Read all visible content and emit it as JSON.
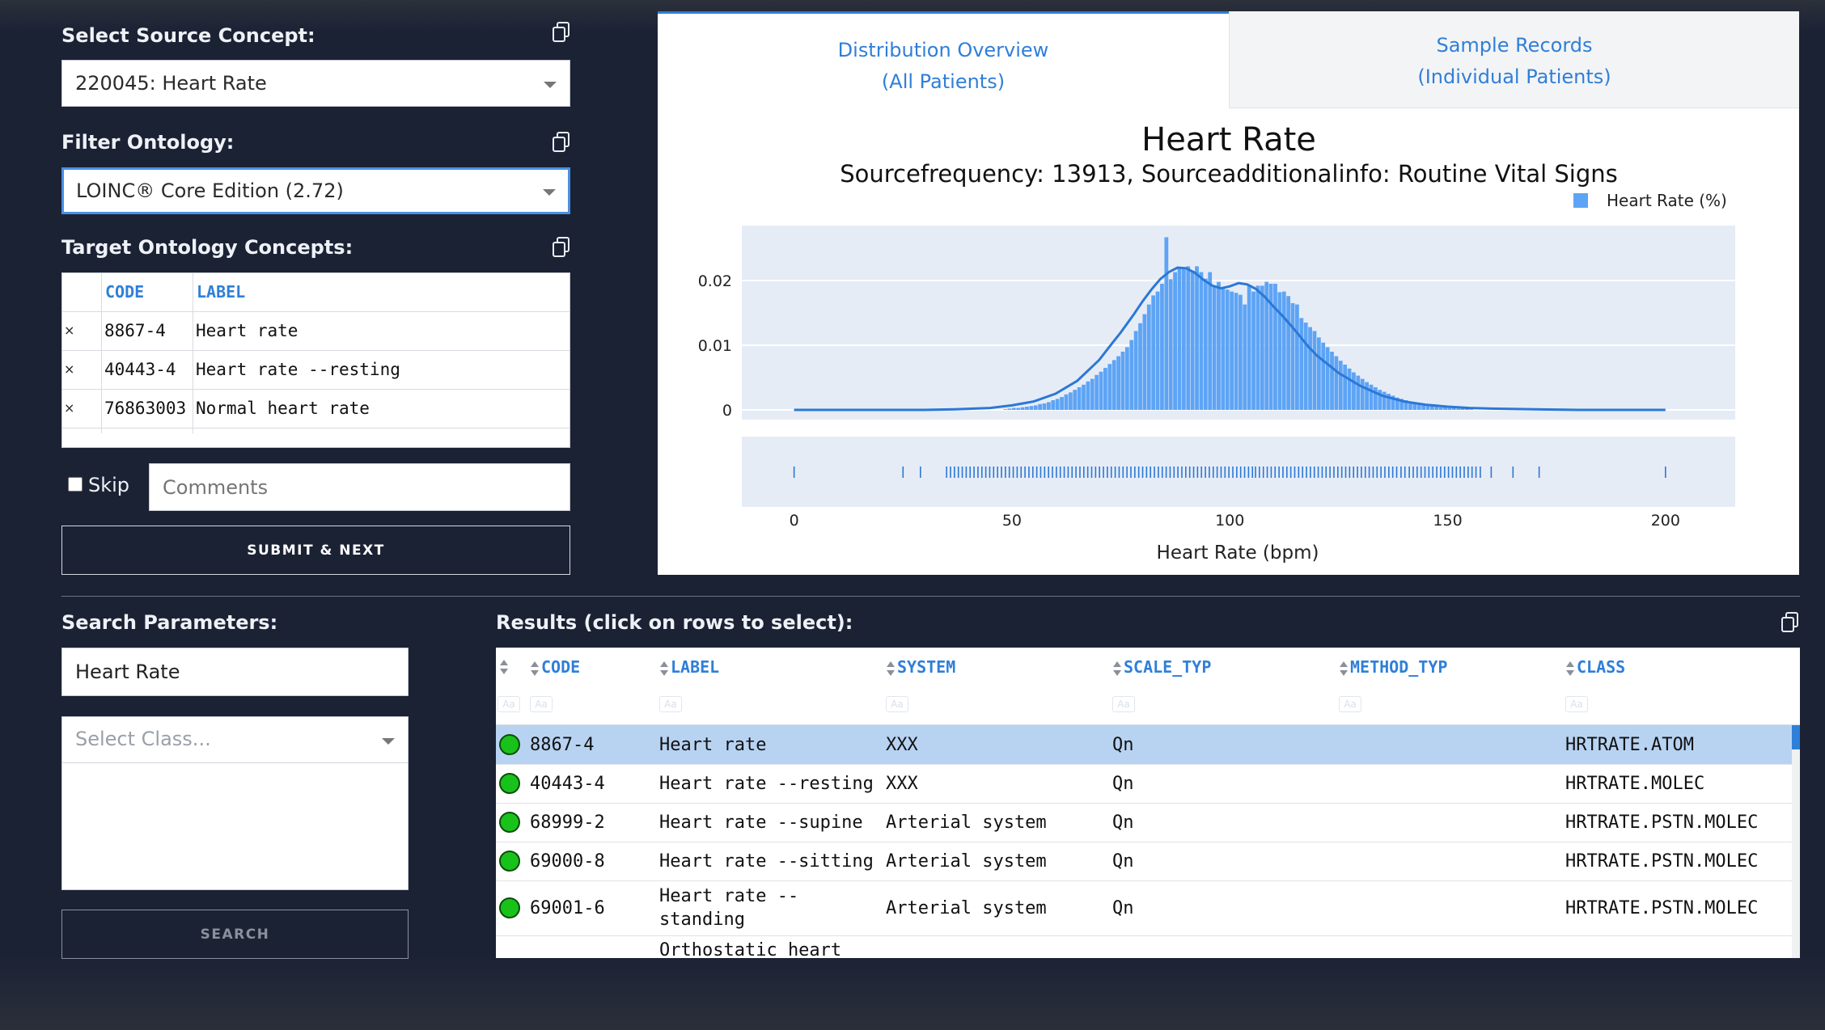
{
  "source": {
    "label": "Select Source Concept:",
    "value": "220045: Heart Rate"
  },
  "ontology": {
    "label": "Filter Ontology:",
    "value": "LOINC® Core Edition (2.72)"
  },
  "targets": {
    "label": "Target Ontology Concepts:",
    "headers": [
      "CODE",
      "LABEL"
    ],
    "rows": [
      {
        "remove": "×",
        "code": "8867-4",
        "label": "Heart rate"
      },
      {
        "remove": "×",
        "code": "40443-4",
        "label": "Heart rate --resting"
      },
      {
        "remove": "×",
        "code": "76863003",
        "label": "Normal heart rate"
      }
    ]
  },
  "skip": {
    "label": "Skip",
    "checked": false
  },
  "comments": {
    "placeholder": "Comments"
  },
  "submit_label": "SUBMIT & NEXT",
  "search": {
    "label": "Search Parameters:",
    "query": "Heart Rate",
    "class_placeholder": "Select Class...",
    "button_label": "SEARCH"
  },
  "tabs": [
    {
      "line1": "Distribution Overview",
      "line2": "(All Patients)",
      "active": true
    },
    {
      "line1": "Sample Records",
      "line2": "(Individual Patients)",
      "active": false
    }
  ],
  "results": {
    "label": "Results (click on rows to select):",
    "headers": [
      "CODE",
      "LABEL",
      "SYSTEM",
      "SCALE_TYP",
      "METHOD_TYP",
      "CLASS"
    ],
    "filter_glyph": "Aa",
    "rows": [
      {
        "code": "8867-4",
        "label": "Heart rate",
        "system": "XXX",
        "scale": "Qn",
        "method": "",
        "class": "HRTRATE.ATOM",
        "selected": true
      },
      {
        "code": "40443-4",
        "label": "Heart rate --resting",
        "system": "XXX",
        "scale": "Qn",
        "method": "",
        "class": "HRTRATE.MOLEC"
      },
      {
        "code": "68999-2",
        "label": "Heart rate --supine",
        "system": "Arterial system",
        "scale": "Qn",
        "method": "",
        "class": "HRTRATE.PSTN.MOLEC"
      },
      {
        "code": "69000-8",
        "label": "Heart rate --sitting",
        "system": "Arterial system",
        "scale": "Qn",
        "method": "",
        "class": "HRTRATE.PSTN.MOLEC"
      },
      {
        "code": "69001-6",
        "label_line1": "Heart rate --",
        "label_line2": "standing",
        "system": "Arterial system",
        "scale": "Qn",
        "method": "",
        "class": "HRTRATE.PSTN.MOLEC"
      }
    ],
    "partial_row_label": "Orthostatic heart"
  },
  "colors": {
    "accent": "#2f7fd8",
    "bar": "#5ea4f5",
    "line": "#2b78d6",
    "plot_bg": "#e6ecf6",
    "selected_row": "#b8d3f2",
    "status_green": "#18c21a"
  },
  "chart_data": {
    "type": "histogram",
    "title": "Heart Rate",
    "subtitle": "Sourcefrequency: 13913, Sourceadditionalinfo: Routine Vital Signs",
    "legend": {
      "label": "Heart Rate (%)",
      "placement": "top-right"
    },
    "xlabel": "Heart Rate (bpm)",
    "xlim": [
      -12,
      216
    ],
    "ylim": [
      -0.0015,
      0.0285
    ],
    "x_ticks": [
      0,
      50,
      100,
      150,
      200
    ],
    "y_ticks": [
      0,
      0.01,
      0.02
    ],
    "y_tick_labels": [
      "0",
      "0.01",
      "0.02"
    ],
    "histogram": {
      "bin_width": 1,
      "x_start": 48,
      "values": [
        0.0001,
        0.0002,
        0.0003,
        0.0003,
        0.0004,
        0.0005,
        0.0006,
        0.0007,
        0.0009,
        0.001,
        0.0012,
        0.0015,
        0.0017,
        0.002,
        0.0024,
        0.0027,
        0.0031,
        0.0035,
        0.0039,
        0.0044,
        0.0048,
        0.0054,
        0.0059,
        0.0065,
        0.0071,
        0.0077,
        0.0083,
        0.009,
        0.0097,
        0.0108,
        0.0122,
        0.0134,
        0.0148,
        0.0163,
        0.0177,
        0.0183,
        0.0195,
        0.0267,
        0.0202,
        0.0213,
        0.022,
        0.0218,
        0.0222,
        0.0215,
        0.0222,
        0.0213,
        0.0203,
        0.0213,
        0.0192,
        0.0198,
        0.0188,
        0.0186,
        0.0183,
        0.0181,
        0.0178,
        0.0163,
        0.0193,
        0.0183,
        0.0192,
        0.0192,
        0.0198,
        0.0195,
        0.0195,
        0.0182,
        0.0183,
        0.0176,
        0.0165,
        0.0163,
        0.0142,
        0.0135,
        0.0128,
        0.0122,
        0.0112,
        0.0104,
        0.0097,
        0.009,
        0.0083,
        0.0076,
        0.007,
        0.0064,
        0.0058,
        0.0053,
        0.0048,
        0.0043,
        0.0039,
        0.0035,
        0.0031,
        0.0028,
        0.0025,
        0.0022,
        0.0019,
        0.0017,
        0.0015,
        0.0013,
        0.0011,
        0.001,
        0.0008,
        0.0007,
        0.0006,
        0.0005,
        0.0004,
        0.0004,
        0.0003,
        0.0003,
        0.0002,
        0.0002,
        0.0002,
        0.0001
      ]
    },
    "density_curve": {
      "x": [
        0,
        20,
        30,
        37,
        45,
        50,
        55,
        60,
        65,
        70,
        73,
        75,
        78,
        80,
        82,
        84,
        86,
        88,
        90,
        92,
        94,
        96,
        98,
        100,
        102,
        104,
        106,
        108,
        110,
        112,
        115,
        118,
        120,
        125,
        130,
        135,
        140,
        145,
        150,
        155,
        160,
        170,
        180,
        200
      ],
      "y": [
        0,
        0,
        0,
        0.0001,
        0.0003,
        0.0007,
        0.0013,
        0.0025,
        0.0045,
        0.0077,
        0.0103,
        0.012,
        0.0148,
        0.0168,
        0.0186,
        0.0202,
        0.0213,
        0.022,
        0.0219,
        0.0212,
        0.0201,
        0.0192,
        0.0188,
        0.0191,
        0.0196,
        0.0194,
        0.0187,
        0.0175,
        0.016,
        0.0146,
        0.0123,
        0.0098,
        0.0084,
        0.0057,
        0.0037,
        0.0022,
        0.0013,
        0.0008,
        0.0005,
        0.0003,
        0.0002,
        0.0001,
        0,
        0
      ]
    },
    "rug_x": [
      0,
      25,
      29,
      35,
      35.9,
      36.8,
      37.7,
      38.6,
      39.5,
      40.4,
      41.3,
      42.2,
      43.1,
      44,
      44.9,
      45.8,
      46.7,
      47.6,
      48.5,
      49.4,
      50.3,
      51.2,
      52.1,
      53,
      53.9,
      54.8,
      55.7,
      56.6,
      57.5,
      58.4,
      59.3,
      60.2,
      61.1,
      62,
      62.9,
      63.8,
      64.7,
      65.6,
      66.5,
      67.4,
      68.3,
      69.2,
      70.1,
      71,
      71.9,
      72.8,
      73.7,
      74.6,
      75.5,
      76.4,
      77.3,
      78.2,
      79.1,
      80,
      80.9,
      81.8,
      82.7,
      83.6,
      84.5,
      85.4,
      86.3,
      87.2,
      88.1,
      89,
      89.9,
      90.8,
      91.7,
      92.6,
      93.5,
      94.4,
      95.3,
      96.2,
      97.1,
      98,
      98.9,
      99.8,
      100.7,
      101.6,
      102.5,
      103.4,
      104.3,
      105.2,
      105.9,
      106.8,
      107.7,
      108.6,
      109.5,
      110.4,
      111.3,
      112.2,
      113.1,
      114,
      114.9,
      115.8,
      116.7,
      117.6,
      118.5,
      119.4,
      120.3,
      121.2,
      122.1,
      123,
      123.9,
      124.8,
      125.7,
      126.6,
      127.5,
      128.4,
      129.3,
      130.2,
      131.1,
      132,
      132.9,
      133.8,
      134.7,
      135.6,
      136.5,
      137.4,
      138.3,
      139.3,
      140.2,
      141.2,
      142.1,
      143,
      143.9,
      144.8,
      145.7,
      146.6,
      147.5,
      148.4,
      149.3,
      150.2,
      151.1,
      152,
      152.9,
      153.8,
      154.7,
      155.6,
      156.5,
      157.5,
      160,
      165,
      171,
      200
    ]
  }
}
